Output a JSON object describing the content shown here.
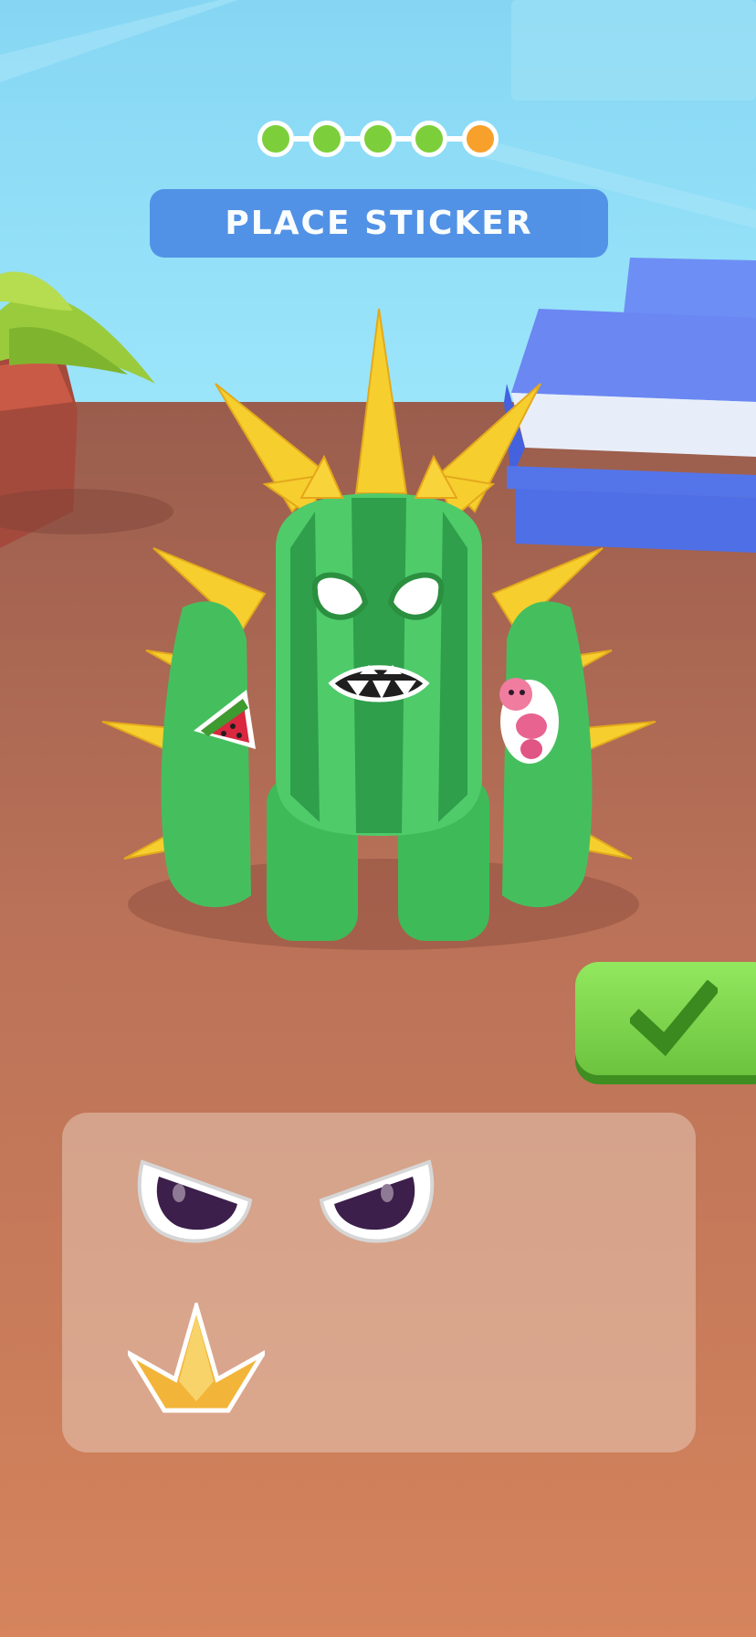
{
  "title": "PLACE STICKER",
  "progress": {
    "total_steps": 5,
    "completed_steps": 4,
    "current_step": 5,
    "completed_color": "#7ccf3a",
    "current_color": "#f7a02b"
  },
  "confirm_button": {
    "icon": "checkmark-icon",
    "accent": "#7cd446"
  },
  "sticker_tray": {
    "stickers": [
      {
        "name": "angry-eyes-sticker"
      },
      {
        "name": "crown-spikes-sticker"
      }
    ]
  },
  "character": {
    "name": "cactus-monster",
    "applied_stickers": [
      "watermelon-slice-sticker",
      "pink-worm-sticker"
    ]
  },
  "colors": {
    "sky": "#8fdcf5",
    "floor": "#c97a57",
    "cactus": "#4fc86a",
    "spikes": "#f8d43a",
    "banner": "#4f8ee6"
  }
}
